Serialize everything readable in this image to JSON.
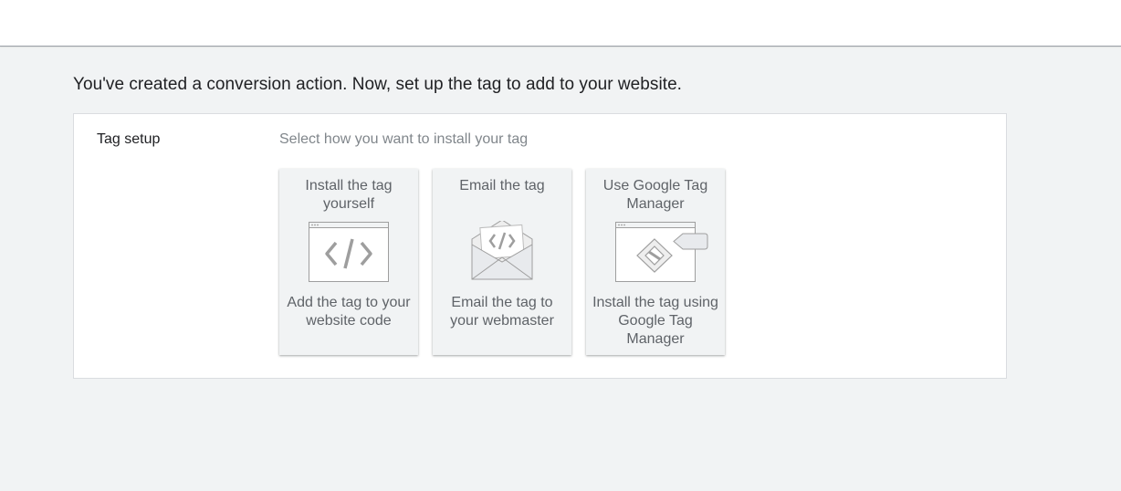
{
  "headline": "You've created a conversion action. Now, set up the tag to add to your website.",
  "tag_setup": {
    "label": "Tag setup",
    "instruction": "Select how you want to install your tag",
    "options": [
      {
        "title": "Install the tag yourself",
        "description": "Add the tag to your website code",
        "icon": "browser-code-icon"
      },
      {
        "title": "Email the tag",
        "description": "Email the tag to your webmaster",
        "icon": "email-code-icon"
      },
      {
        "title": "Use Google Tag Manager",
        "description": "Install the tag using Google Tag Manager",
        "icon": "tag-manager-icon"
      }
    ]
  },
  "colors": {
    "page_background": "#f1f3f4",
    "panel_background": "#ffffff",
    "card_background": "#f1f3f4",
    "secondary_text": "#5f6368",
    "icon_stroke": "#9e9e9e"
  }
}
